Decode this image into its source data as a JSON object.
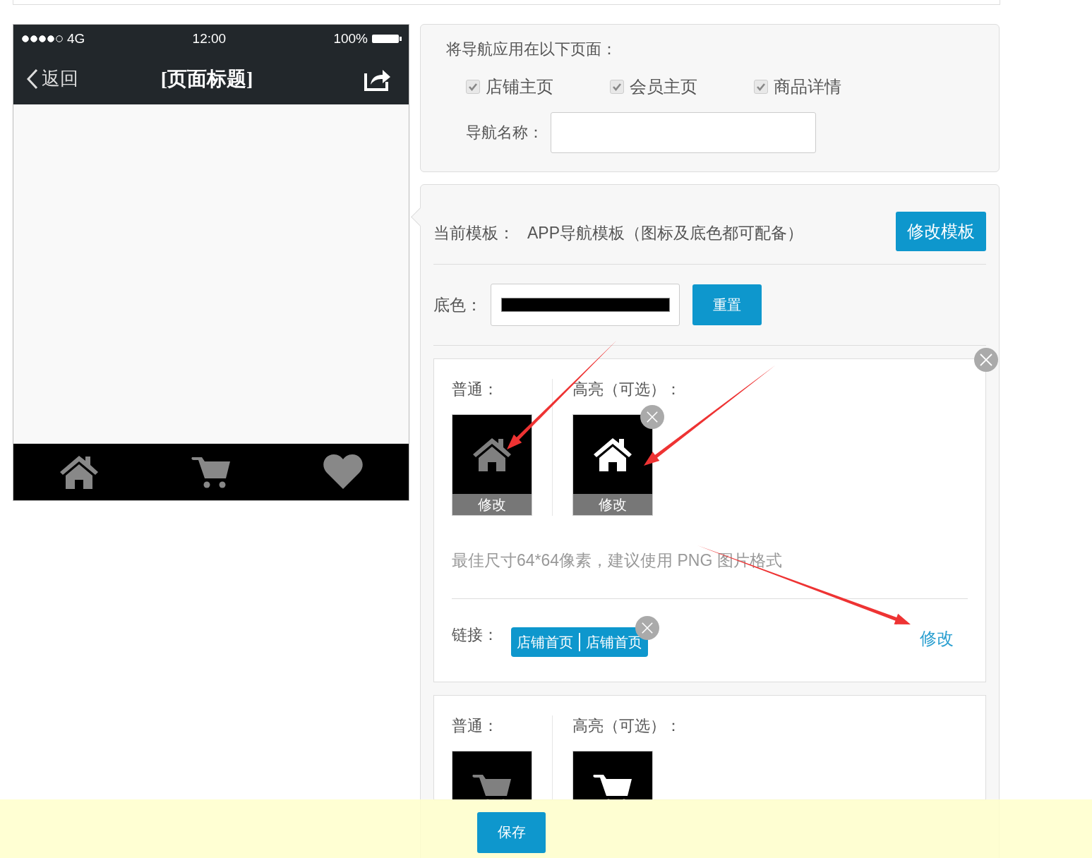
{
  "phone": {
    "carrier": "4G",
    "time": "12:00",
    "battery": "100%",
    "back": "返回",
    "title": "[页面标题]",
    "tabbar": [
      {
        "kind": "home"
      },
      {
        "kind": "cart"
      },
      {
        "kind": "heart"
      }
    ]
  },
  "apply_panel": {
    "title": "将导航应用在以下页面：",
    "pages": [
      {
        "label": "店铺主页",
        "checked": true
      },
      {
        "label": "会员主页",
        "checked": true
      },
      {
        "label": "商品详情",
        "checked": true
      }
    ],
    "name_label": "导航名称："
  },
  "template_panel": {
    "label": "当前模板：",
    "value": "APP导航模板（图标及底色都可配备）",
    "edit_button": "修改模板",
    "bg_label": "底色：",
    "reset_button": "重置"
  },
  "nav_items": [
    {
      "kind": "home",
      "normal_label": "普通：",
      "highlight_label": "高亮（可选）：",
      "normal_caption": "修改",
      "highlight_caption": "修改",
      "hint": "最佳尺寸64*64像素，建议使用 PNG 图片格式",
      "link_label": "链接：",
      "link_tag": [
        "店铺首页",
        "店铺首页"
      ],
      "link_edit": "修改"
    },
    {
      "kind": "cart",
      "normal_label": "普通：",
      "highlight_label": "高亮（可选）："
    }
  ],
  "save_button": "保存"
}
